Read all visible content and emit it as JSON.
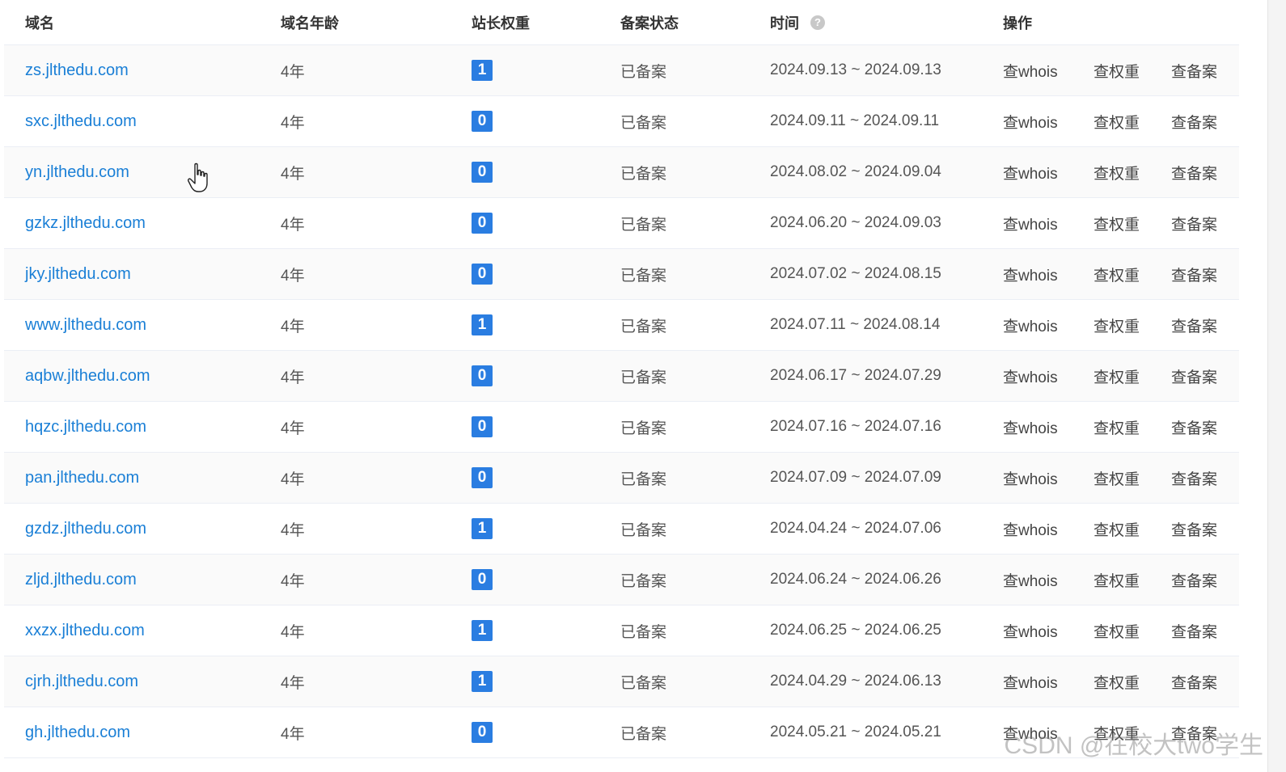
{
  "table": {
    "headers": {
      "domain": "域名",
      "age": "域名年龄",
      "weight": "站长权重",
      "beian": "备案状态",
      "time": "时间",
      "ops": "操作"
    },
    "help_icon": "question-circle-icon",
    "rows": [
      {
        "domain": "zs.jlthedu.com",
        "age": "4年",
        "weight": "1",
        "beian": "已备案",
        "time": "2024.09.13 ~ 2024.09.13",
        "op_whois": "查whois",
        "op_weight": "查权重",
        "op_beian": "查备案"
      },
      {
        "domain": "sxc.jlthedu.com",
        "age": "4年",
        "weight": "0",
        "beian": "已备案",
        "time": "2024.09.11 ~ 2024.09.11",
        "op_whois": "查whois",
        "op_weight": "查权重",
        "op_beian": "查备案"
      },
      {
        "domain": "yn.jlthedu.com",
        "age": "4年",
        "weight": "0",
        "beian": "已备案",
        "time": "2024.08.02 ~ 2024.09.04",
        "op_whois": "查whois",
        "op_weight": "查权重",
        "op_beian": "查备案"
      },
      {
        "domain": "gzkz.jlthedu.com",
        "age": "4年",
        "weight": "0",
        "beian": "已备案",
        "time": "2024.06.20 ~ 2024.09.03",
        "op_whois": "查whois",
        "op_weight": "查权重",
        "op_beian": "查备案"
      },
      {
        "domain": "jky.jlthedu.com",
        "age": "4年",
        "weight": "0",
        "beian": "已备案",
        "time": "2024.07.02 ~ 2024.08.15",
        "op_whois": "查whois",
        "op_weight": "查权重",
        "op_beian": "查备案"
      },
      {
        "domain": "www.jlthedu.com",
        "age": "4年",
        "weight": "1",
        "beian": "已备案",
        "time": "2024.07.11 ~ 2024.08.14",
        "op_whois": "查whois",
        "op_weight": "查权重",
        "op_beian": "查备案"
      },
      {
        "domain": "aqbw.jlthedu.com",
        "age": "4年",
        "weight": "0",
        "beian": "已备案",
        "time": "2024.06.17 ~ 2024.07.29",
        "op_whois": "查whois",
        "op_weight": "查权重",
        "op_beian": "查备案"
      },
      {
        "domain": "hqzc.jlthedu.com",
        "age": "4年",
        "weight": "0",
        "beian": "已备案",
        "time": "2024.07.16 ~ 2024.07.16",
        "op_whois": "查whois",
        "op_weight": "查权重",
        "op_beian": "查备案"
      },
      {
        "domain": "pan.jlthedu.com",
        "age": "4年",
        "weight": "0",
        "beian": "已备案",
        "time": "2024.07.09 ~ 2024.07.09",
        "op_whois": "查whois",
        "op_weight": "查权重",
        "op_beian": "查备案"
      },
      {
        "domain": "gzdz.jlthedu.com",
        "age": "4年",
        "weight": "1",
        "beian": "已备案",
        "time": "2024.04.24 ~ 2024.07.06",
        "op_whois": "查whois",
        "op_weight": "查权重",
        "op_beian": "查备案"
      },
      {
        "domain": "zljd.jlthedu.com",
        "age": "4年",
        "weight": "0",
        "beian": "已备案",
        "time": "2024.06.24 ~ 2024.06.26",
        "op_whois": "查whois",
        "op_weight": "查权重",
        "op_beian": "查备案"
      },
      {
        "domain": "xxzx.jlthedu.com",
        "age": "4年",
        "weight": "1",
        "beian": "已备案",
        "time": "2024.06.25 ~ 2024.06.25",
        "op_whois": "查whois",
        "op_weight": "查权重",
        "op_beian": "查备案"
      },
      {
        "domain": "cjrh.jlthedu.com",
        "age": "4年",
        "weight": "1",
        "beian": "已备案",
        "time": "2024.04.29 ~ 2024.06.13",
        "op_whois": "查whois",
        "op_weight": "查权重",
        "op_beian": "查备案"
      },
      {
        "domain": "gh.jlthedu.com",
        "age": "4年",
        "weight": "0",
        "beian": "已备案",
        "time": "2024.05.21 ~ 2024.05.21",
        "op_whois": "查whois",
        "op_weight": "查权重",
        "op_beian": "查备案"
      }
    ]
  },
  "colors": {
    "link": "#1a7fd6",
    "badge": "#2a7de1",
    "row_alt": "#fafafa",
    "border": "#ebeef5"
  },
  "cursor_icon": "hand-pointer-icon",
  "watermark": "CSDN @在校大two学生"
}
